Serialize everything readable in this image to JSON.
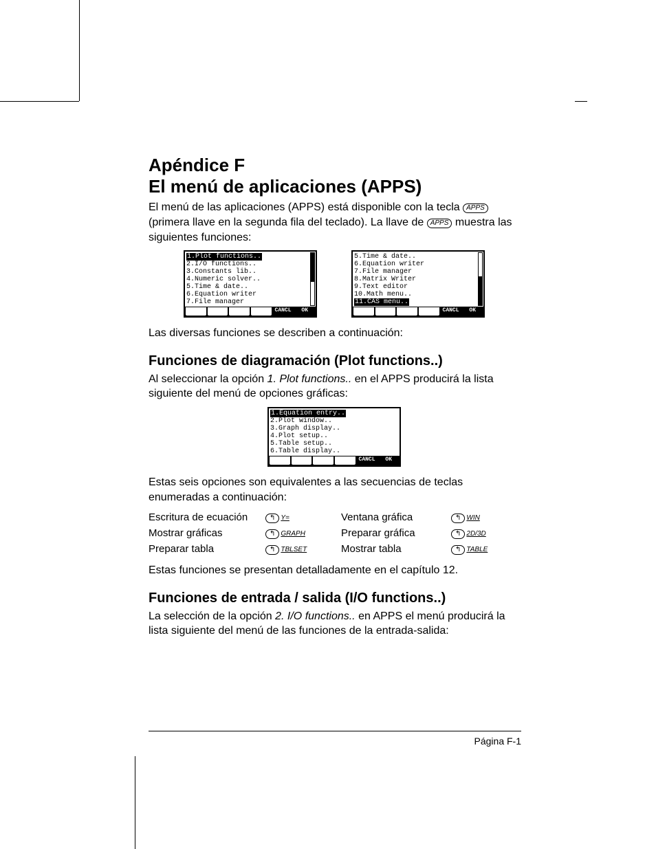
{
  "title_line1": "Apéndice F",
  "title_line2": "El menú de aplicaciones (APPS)",
  "intro_1a": "El menú de las aplicaciones (APPS) está disponible con la tecla ",
  "intro_1_key": "APPS",
  "intro_1b": " (primera llave en la segunda fila del teclado). La llave de ",
  "intro_1c": " muestra las siguientes funciones:",
  "screens_top": {
    "left": {
      "items": [
        "1.Plot functions..",
        "2.I/O functions..",
        "3.Constants lib..",
        "4.Numeric solver..",
        "5.Time & date..",
        "6.Equation writer",
        "7.File manager"
      ],
      "selected_index": 0,
      "scroll_top": true,
      "softkeys": [
        "",
        "",
        "",
        "",
        "CANCL",
        "OK"
      ]
    },
    "right": {
      "items": [
        "5.Time & date..",
        "6.Equation writer",
        "7.File manager",
        "8.Matrix Writer",
        "9.Text editor",
        "10.Math menu..",
        "11.CAS menu.."
      ],
      "selected_index": 6,
      "scroll_top": false,
      "softkeys": [
        "",
        "",
        "",
        "",
        "CANCL",
        "OK"
      ]
    }
  },
  "after_screens": "Las diversas funciones se describen a continuación:",
  "sec1_title": "Funciones de diagramación (Plot functions..)",
  "sec1_p1a": "Al seleccionar la opción ",
  "sec1_p1_ital": "1. Plot functions..",
  "sec1_p1b": " en el APPS producirá la lista siguiente del menú de opciones gráficas:",
  "screen_plot": {
    "items": [
      "1.Equation entry..",
      "2.Plot window..",
      "3.Graph display..",
      "4.Plot setup..",
      "5.Table setup..",
      "6.Table display.."
    ],
    "selected_index": 0,
    "softkeys": [
      "",
      "",
      "",
      "",
      "CANCL",
      "OK"
    ]
  },
  "sec1_p2": "Estas seis opciones son equivalentes a las secuencias de teclas enumeradas a continuación:",
  "equiv_rows": [
    {
      "l": "Escritura de ecuación",
      "lk": "Y=",
      "r": "Ventana gráfica",
      "rk": "WIN"
    },
    {
      "l": "Mostrar gráficas",
      "lk": "GRAPH",
      "r": "Preparar gráfica",
      "rk": "2D/3D"
    },
    {
      "l": "Preparar tabla",
      "lk": "TBLSET",
      "r": "Mostrar tabla",
      "rk": "TABLE"
    }
  ],
  "sec1_p3": "Estas funciones se presentan detalladamente en el capítulo 12.",
  "sec2_title": "Funciones de entrada / salida (I/O functions..)",
  "sec2_p1a": "La selección de la opción ",
  "sec2_p1_ital": "2. I/O functions..",
  "sec2_p1b": " en APPS el menú producirá la lista siguiente del menú de las funciones de la entrada-salida:",
  "footer": "Página F-1"
}
